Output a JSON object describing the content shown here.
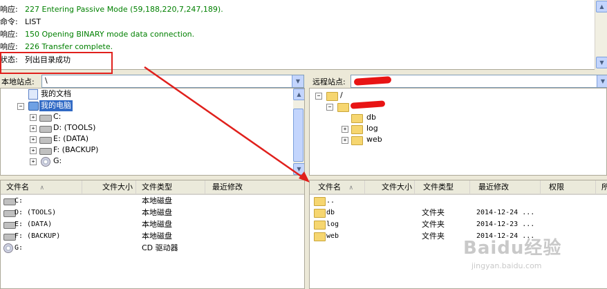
{
  "log": {
    "lines": [
      {
        "prefix": "响应:",
        "text": "227 Entering Passive Mode (59,188,220,7,247,189).",
        "color": "green"
      },
      {
        "prefix": "命令:",
        "text": "LIST",
        "color": "black"
      },
      {
        "prefix": "响应:",
        "text": "150 Opening BINARY mode data connection.",
        "color": "green"
      },
      {
        "prefix": "响应:",
        "text": "226 Transfer complete.",
        "color": "green"
      },
      {
        "prefix": "状态:",
        "text": "列出目录成功",
        "color": "black"
      }
    ]
  },
  "local_site": {
    "label": "本地站点:",
    "value": "\\"
  },
  "remote_site": {
    "label": "远程站点:",
    "value": ""
  },
  "local_tree": {
    "items": [
      {
        "label": "我的文档",
        "icon": "document-folder-icon"
      },
      {
        "label": "我的电脑",
        "icon": "computer-icon",
        "selected": true
      },
      {
        "label": "C:",
        "icon": "drive-icon"
      },
      {
        "label": "D:  (TOOLS)",
        "icon": "drive-icon"
      },
      {
        "label": "E:  (DATA)",
        "icon": "drive-icon"
      },
      {
        "label": "F:  (BACKUP)",
        "icon": "drive-icon"
      },
      {
        "label": "G:",
        "icon": "cd-drive-icon"
      }
    ]
  },
  "remote_tree": {
    "items": [
      {
        "label": "/",
        "icon": "folder-icon"
      },
      {
        "label": "",
        "icon": "folder-icon"
      },
      {
        "label": "db",
        "icon": "folder-icon"
      },
      {
        "label": "log",
        "icon": "folder-icon"
      },
      {
        "label": "web",
        "icon": "folder-icon"
      }
    ]
  },
  "local_list": {
    "columns": {
      "name": "文件名",
      "size": "文件大小",
      "type": "文件类型",
      "modified": "最近修改"
    },
    "rows": [
      {
        "name": "C:",
        "type": "本地磁盘"
      },
      {
        "name": "D:  (TOOLS)",
        "type": "本地磁盘"
      },
      {
        "name": "E:  (DATA)",
        "type": "本地磁盘"
      },
      {
        "name": "F:  (BACKUP)",
        "type": "本地磁盘"
      },
      {
        "name": "G:",
        "type": "CD 驱动器"
      }
    ]
  },
  "remote_list": {
    "columns": {
      "name": "文件名",
      "size": "文件大小",
      "type": "文件类型",
      "modified": "最近修改",
      "perms": "权限",
      "owner": "所"
    },
    "rows": [
      {
        "name": "..",
        "type": "",
        "modified": ""
      },
      {
        "name": "db",
        "type": "文件夹",
        "modified": "2014-12-24 ..."
      },
      {
        "name": "log",
        "type": "文件夹",
        "modified": "2014-12-23 ..."
      },
      {
        "name": "web",
        "type": "文件夹",
        "modified": "2014-12-24 ..."
      }
    ]
  },
  "sort_indicator": "∧",
  "watermark": {
    "text": "Baidu经验",
    "url": "jingyan.baidu.com"
  },
  "colors": {
    "log_green": "#008000",
    "annotation_red": "#e0201c",
    "selection_blue": "#316ac5"
  }
}
